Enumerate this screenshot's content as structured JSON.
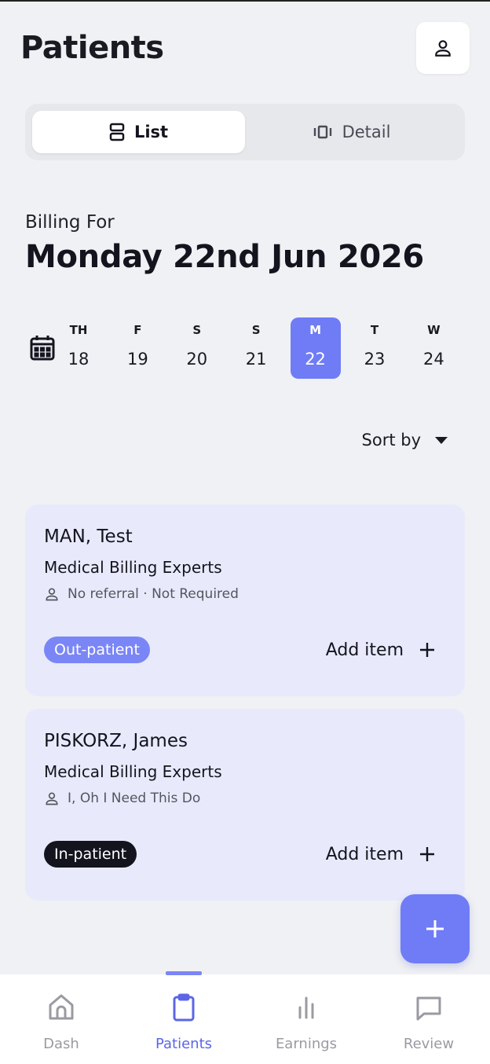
{
  "header": {
    "title": "Patients",
    "profile_icon": "person-icon"
  },
  "view_toggle": {
    "options": [
      {
        "label": "List",
        "icon": "list-view-icon",
        "active": true
      },
      {
        "label": "Detail",
        "icon": "carousel-view-icon",
        "active": false
      }
    ]
  },
  "billing": {
    "label": "Billing For",
    "date": "Monday 22nd Jun 2026"
  },
  "week": {
    "calendar_icon": "calendar-icon",
    "days": [
      {
        "name": "TH",
        "num": "18"
      },
      {
        "name": "F",
        "num": "19"
      },
      {
        "name": "S",
        "num": "20"
      },
      {
        "name": "S",
        "num": "21"
      },
      {
        "name": "M",
        "num": "22",
        "selected": true
      },
      {
        "name": "T",
        "num": "23"
      },
      {
        "name": "W",
        "num": "24"
      }
    ],
    "accent": "#6f7cf6"
  },
  "sort": {
    "label": "Sort by"
  },
  "patients": [
    {
      "name": "MAN, Test",
      "org": "Medical Billing Experts",
      "referral": "No referral · Not Required",
      "type": "Out-patient",
      "type_color": "#7a86f6",
      "action": "Add item"
    },
    {
      "name": "PISKORZ, James",
      "org": "Medical Billing Experts",
      "referral": "I, Oh I Need This Do",
      "type": "In-patient",
      "type_color": "#14141f",
      "action": "Add item"
    }
  ],
  "fab": {
    "icon": "plus-icon"
  },
  "nav": {
    "items": [
      {
        "label": "Dash",
        "icon": "home-icon"
      },
      {
        "label": "Patients",
        "icon": "clipboard-icon",
        "active": true
      },
      {
        "label": "Earnings",
        "icon": "bar-chart-icon"
      },
      {
        "label": "Review",
        "icon": "chat-icon"
      }
    ],
    "active_color": "#5b66e6"
  }
}
